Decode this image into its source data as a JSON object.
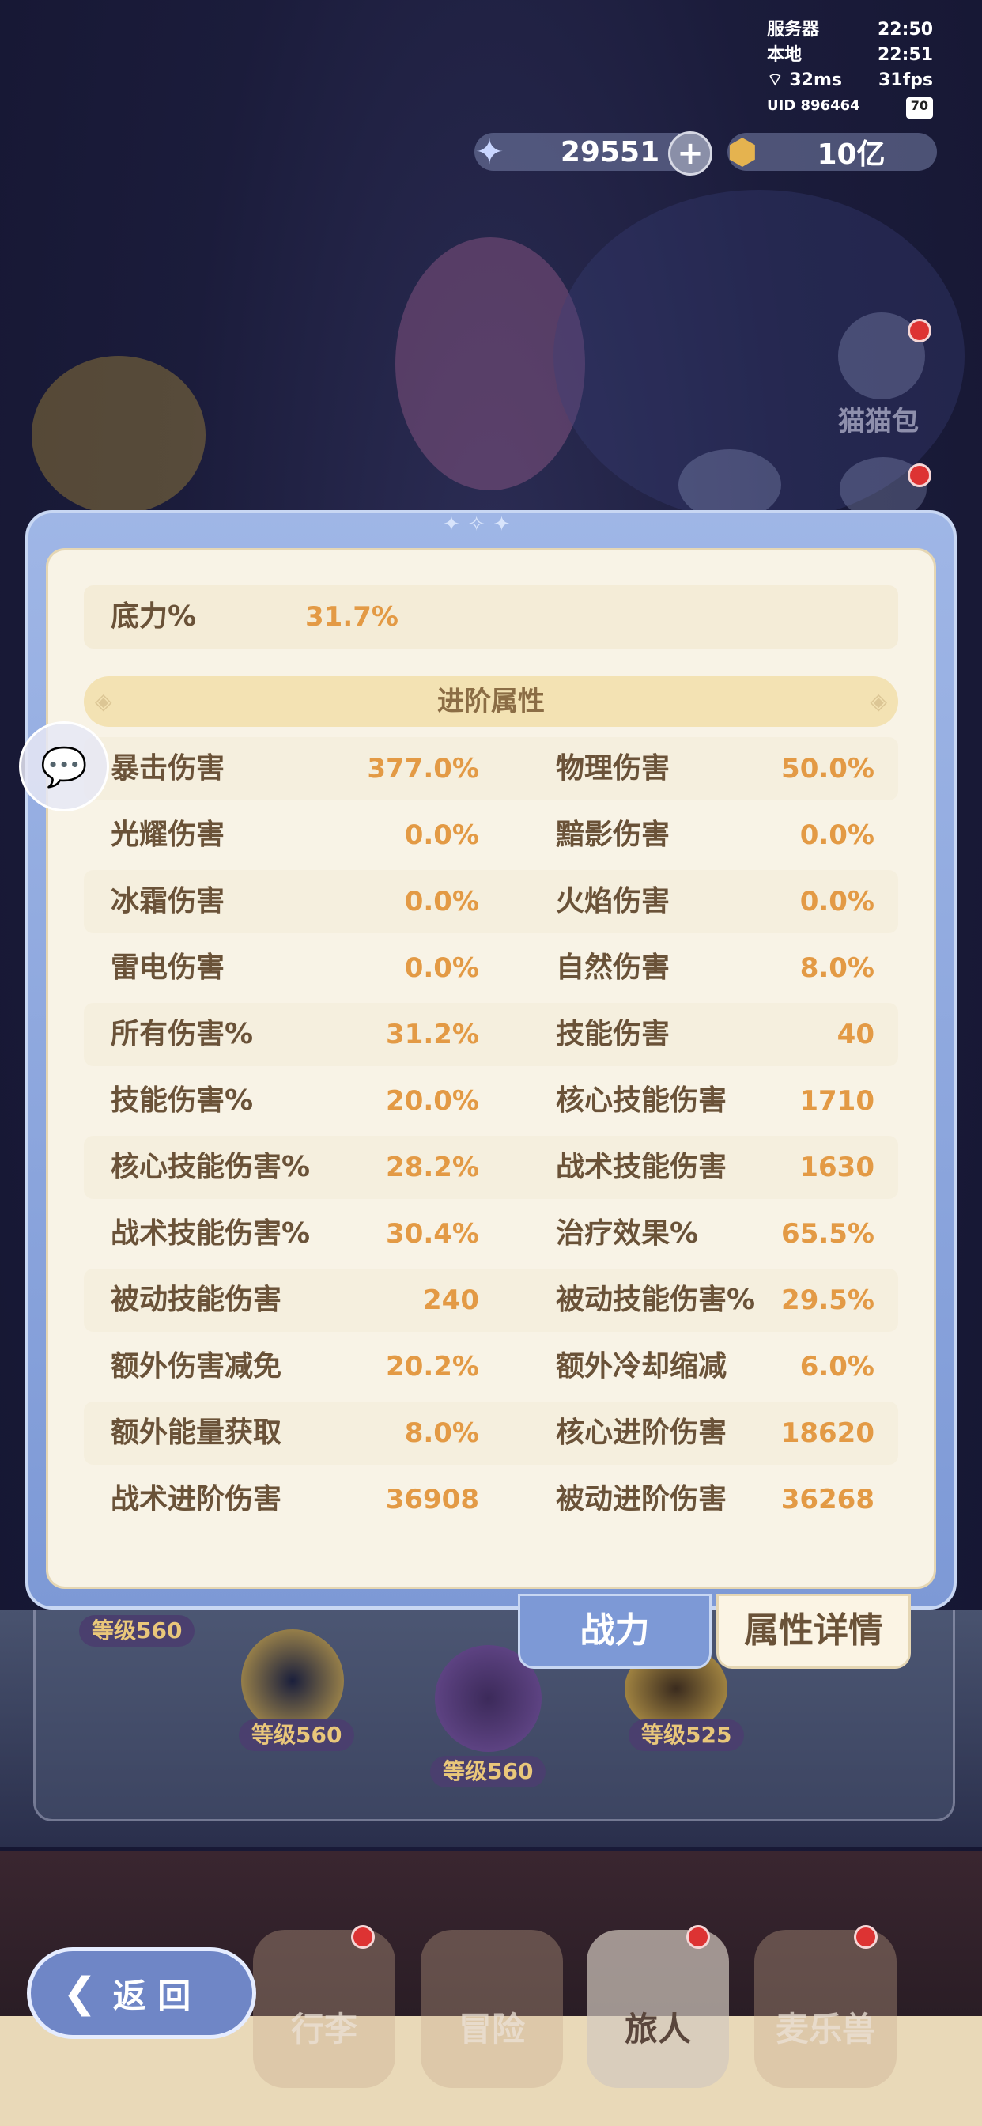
{
  "status": {
    "server_label": "服务器",
    "server_time": "22:50",
    "local_label": "本地",
    "local_time": "22:51",
    "ping": "32ms",
    "fps": "31fps",
    "uid": "UID 896464",
    "battery": "70"
  },
  "currency": {
    "gems": "29551",
    "gold": "10亿"
  },
  "side": {
    "cat_bag_label": "猫猫包"
  },
  "panel": {
    "basic": {
      "label": "底力%",
      "value": "31.7%"
    },
    "section_title": "进阶属性",
    "rows": [
      {
        "l1": "暴击伤害",
        "v1": "377.0%",
        "l2": "物理伤害",
        "v2": "50.0%"
      },
      {
        "l1": "光耀伤害",
        "v1": "0.0%",
        "l2": "黯影伤害",
        "v2": "0.0%"
      },
      {
        "l1": "冰霜伤害",
        "v1": "0.0%",
        "l2": "火焰伤害",
        "v2": "0.0%"
      },
      {
        "l1": "雷电伤害",
        "v1": "0.0%",
        "l2": "自然伤害",
        "v2": "8.0%"
      },
      {
        "l1": "所有伤害%",
        "v1": "31.2%",
        "l2": "技能伤害",
        "v2": "40"
      },
      {
        "l1": "技能伤害%",
        "v1": "20.0%",
        "l2": "核心技能伤害",
        "v2": "1710"
      },
      {
        "l1": "核心技能伤害%",
        "v1": "28.2%",
        "l2": "战术技能伤害",
        "v2": "1630"
      },
      {
        "l1": "战术技能伤害%",
        "v1": "30.4%",
        "l2": "治疗效果%",
        "v2": "65.5%"
      },
      {
        "l1": "被动技能伤害",
        "v1": "240",
        "l2": "被动技能伤害%",
        "v2": "29.5%"
      },
      {
        "l1": "额外伤害减免",
        "v1": "20.2%",
        "l2": "额外冷却缩减",
        "v2": "6.0%"
      },
      {
        "l1": "额外能量获取",
        "v1": "8.0%",
        "l2": "核心进阶伤害",
        "v2": "18620"
      },
      {
        "l1": "战术进阶伤害",
        "v1": "36908",
        "l2": "被动进阶伤害",
        "v2": "36268"
      }
    ]
  },
  "tabs": {
    "power": "战力",
    "detail": "属性详情"
  },
  "lower": {
    "badges": [
      "等级560",
      "等级560",
      "等级560",
      "等级525"
    ]
  },
  "nav": {
    "back": "返 回",
    "items": [
      "行李",
      "冒险",
      "旅人",
      "麦乐兽"
    ]
  }
}
